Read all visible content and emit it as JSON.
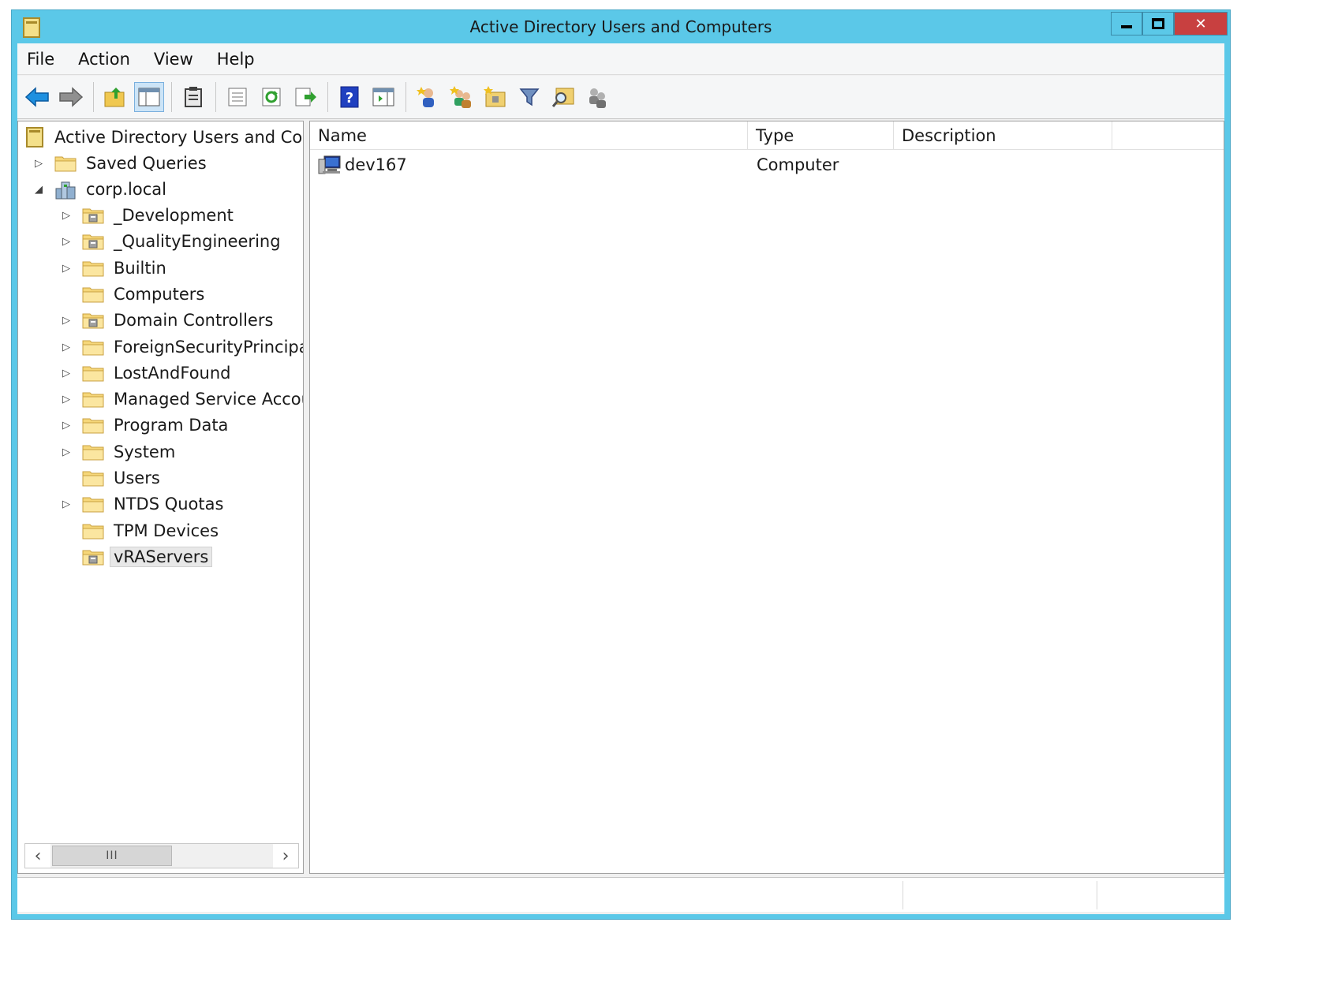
{
  "window": {
    "title": "Active Directory Users and Computers",
    "colors": {
      "titlebar": "#5bc8e8",
      "close_button": "#c84040"
    }
  },
  "menu": [
    "File",
    "Action",
    "View",
    "Help"
  ],
  "toolbar": {
    "icons": [
      "back-arrow-icon",
      "forward-arrow-icon",
      "up-folder-icon",
      "show-hide-console-tree-icon",
      "clipboard-icon",
      "properties-icon",
      "refresh-icon",
      "export-list-icon",
      "help-icon",
      "show-hide-action-pane-icon",
      "new-user-icon",
      "new-group-icon",
      "new-ou-icon",
      "filter-icon",
      "find-icon",
      "add-to-group-icon"
    ]
  },
  "tree": {
    "root": "Active Directory Users and Com",
    "saved_queries": "Saved Queries",
    "domain": "corp.local",
    "children": [
      {
        "label": "_Development",
        "expandable": true,
        "type": "ou"
      },
      {
        "label": "_QualityEngineering",
        "expandable": true,
        "type": "ou"
      },
      {
        "label": "Builtin",
        "expandable": true,
        "type": "folder"
      },
      {
        "label": "Computers",
        "expandable": false,
        "type": "folder"
      },
      {
        "label": "Domain Controllers",
        "expandable": true,
        "type": "ou"
      },
      {
        "label": "ForeignSecurityPrincipals",
        "expandable": true,
        "type": "folder"
      },
      {
        "label": "LostAndFound",
        "expandable": true,
        "type": "folder"
      },
      {
        "label": "Managed Service Accour",
        "expandable": true,
        "type": "folder"
      },
      {
        "label": "Program Data",
        "expandable": true,
        "type": "folder"
      },
      {
        "label": "System",
        "expandable": true,
        "type": "folder"
      },
      {
        "label": "Users",
        "expandable": false,
        "type": "folder"
      },
      {
        "label": "NTDS Quotas",
        "expandable": true,
        "type": "folder"
      },
      {
        "label": "TPM Devices",
        "expandable": false,
        "type": "folder"
      },
      {
        "label": "vRAServers",
        "expandable": false,
        "type": "ou",
        "selected": true
      }
    ],
    "scroll_thumb": "III"
  },
  "list": {
    "columns": [
      "Name",
      "Type",
      "Description"
    ],
    "rows": [
      {
        "name": "dev167",
        "type": "Computer",
        "description": ""
      }
    ]
  }
}
